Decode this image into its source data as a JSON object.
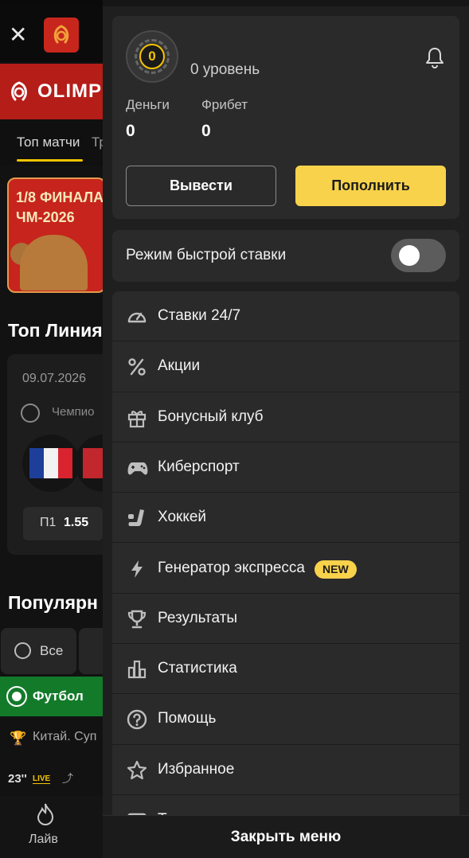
{
  "background": {
    "close_glyph": "✕",
    "brand": "OLIMP",
    "tabs": [
      "Топ матчи",
      "Тр"
    ],
    "promo_lines": [
      "1/8 ФИНАЛА",
      "ЧМ-2026"
    ],
    "top_line_title": "Топ Линия",
    "match_date": "09.07.2026",
    "league": "Чемпио",
    "odd_label": "П1",
    "odd_value": "1.55",
    "popular_title": "Популярн",
    "chip_all": "Все",
    "sport_football": "Футбол",
    "league2": "Китай. Суп",
    "live_minute": "23''",
    "live_badge": "LIVE",
    "bottom_tab_live": "Лайв"
  },
  "profile": {
    "level_value": "0",
    "level_text": "0 уровень",
    "money_label": "Деньги",
    "money_value": "0",
    "freebet_label": "Фрибет",
    "freebet_value": "0",
    "withdraw_label": "Вывести",
    "deposit_label": "Пополнить"
  },
  "quick_bet": {
    "label": "Режим быстрой ставки",
    "enabled": false
  },
  "menu": {
    "items": [
      {
        "label": "Ставки 24/7",
        "icon": "speedometer-icon"
      },
      {
        "label": "Акции",
        "icon": "percent-icon"
      },
      {
        "label": "Бонусный клуб",
        "icon": "gift-icon"
      },
      {
        "label": "Киберспорт",
        "icon": "gamepad-icon"
      },
      {
        "label": "Хоккей",
        "icon": "hockey-icon"
      },
      {
        "label": "Генератор экспресса",
        "icon": "lightning-icon",
        "badge": "NEW"
      },
      {
        "label": "Результаты",
        "icon": "trophy-icon"
      },
      {
        "label": "Статистика",
        "icon": "bar-chart-icon"
      },
      {
        "label": "Помощь",
        "icon": "help-icon"
      },
      {
        "label": "Избранное",
        "icon": "star-icon"
      },
      {
        "label": "Т",
        "icon": "tv-icon"
      }
    ],
    "close_label": "Закрыть меню"
  },
  "colors": {
    "accent": "#f8d24a",
    "panel": "#2a2a2a",
    "drawer": "#1f1f1f",
    "brand_red": "#c7261d",
    "football_green": "#137a2a"
  }
}
